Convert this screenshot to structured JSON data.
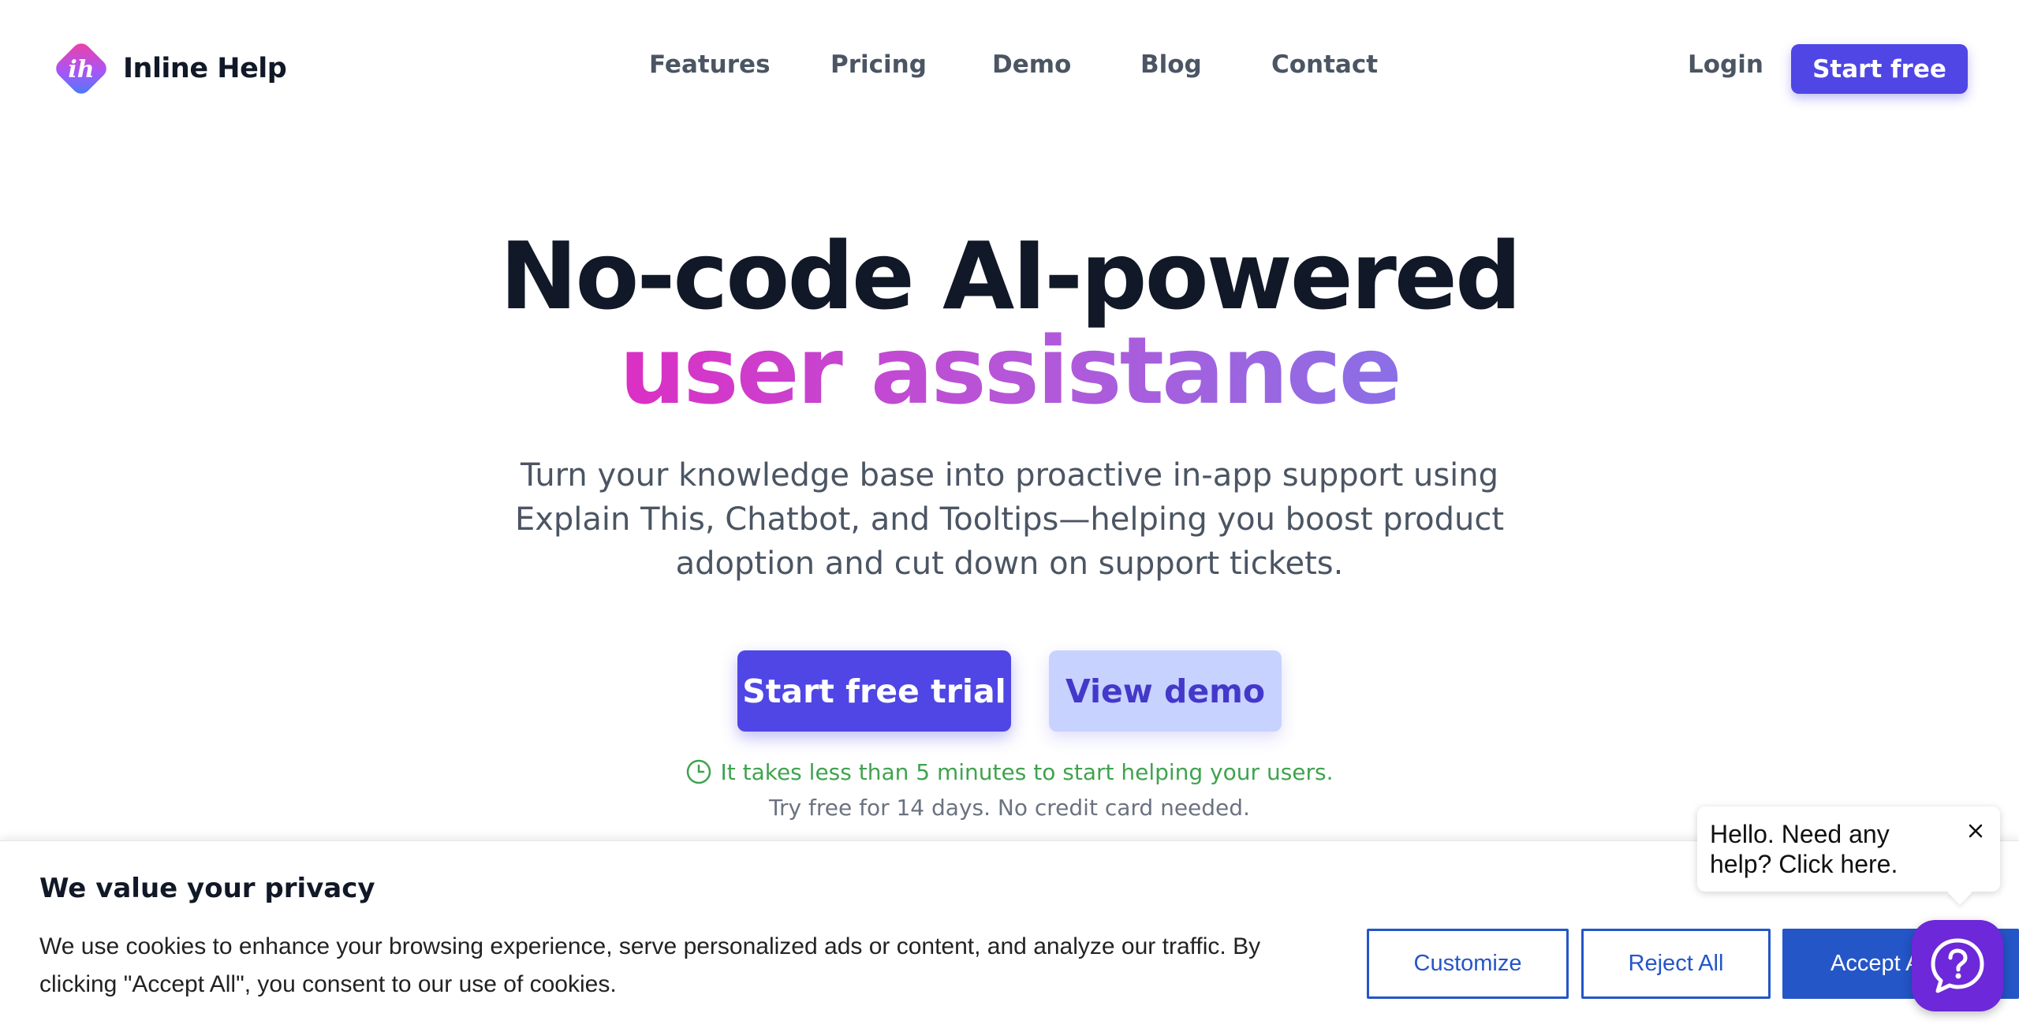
{
  "brand": {
    "name": "Inline Help",
    "logo_letters": "ih",
    "accent_color": "#4f46e5"
  },
  "nav": {
    "items": [
      {
        "label": "Features"
      },
      {
        "label": "Pricing"
      },
      {
        "label": "Demo"
      },
      {
        "label": "Blog"
      },
      {
        "label": "Contact"
      }
    ],
    "login_label": "Login",
    "start_free_label": "Start free"
  },
  "hero": {
    "title_line1": "No-code AI-powered",
    "title_line2": "user assistance",
    "subtitle": "Turn your knowledge base into proactive in-app support using Explain This, Chatbot, and Tooltips—helping you boost product adoption and cut down on support tickets.",
    "primary_cta": "Start free trial",
    "secondary_cta": "View demo",
    "time_note": "It takes less than 5 minutes to start helping your users.",
    "trial_note": "Try free for 14 days. No credit card needed."
  },
  "cookie_banner": {
    "title": "We value your privacy",
    "text": "We use cookies to enhance your browsing experience, serve personalized ads or content, and analyze our traffic. By clicking \"Accept All\", you consent to our use of cookies.",
    "customize_label": "Customize",
    "reject_label": "Reject All",
    "accept_label": "Accept All"
  },
  "help_widget": {
    "bubble_text": "Hello. Need any help? Click here.",
    "launcher_icon": "question-chat-icon",
    "close_icon": "close-icon"
  }
}
